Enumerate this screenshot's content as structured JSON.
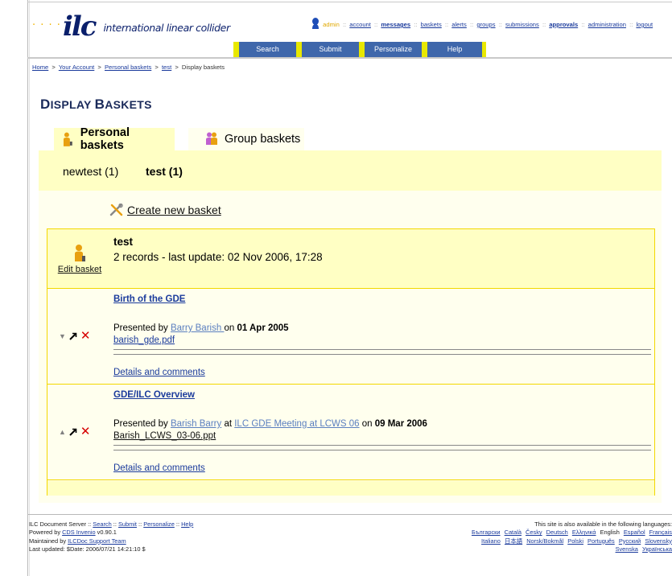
{
  "header": {
    "logo_mark": "ilc",
    "logo_dots": "· · · ·",
    "logo_name": "international linear collider",
    "user_name": "admin",
    "user_links": [
      "account",
      "messages",
      "baskets",
      "alerts",
      "groups",
      "submissions",
      "approvals",
      "administration",
      "logout"
    ],
    "separator": "::"
  },
  "nav": {
    "search": "Search",
    "submit": "Submit",
    "personalize": "Personalize",
    "help": "Help"
  },
  "breadcrumb": {
    "home": "Home",
    "account": "Your Account",
    "personal_baskets": "Personal baskets",
    "test": "test",
    "current": "Display baskets",
    "arrow": ">"
  },
  "page": {
    "title_first": "D",
    "title_rest": "ISPLAY ",
    "title_second": "B",
    "title_rest2": "ASKETS"
  },
  "tabs": {
    "personal": "Personal baskets",
    "group": "Group baskets"
  },
  "subtabs": {
    "first": "newtest (1)",
    "active": "test (1)"
  },
  "actions": {
    "create_basket": "Create new basket"
  },
  "basket": {
    "edit_label": "Edit basket",
    "name": "test",
    "info": "2 records - last update: 02 Nov 2006, 17:28",
    "records": [
      {
        "title": "Birth of the GDE",
        "presented_prefix": "Presented by ",
        "author": "Barry Barish ",
        "mid_text": "",
        "event": "",
        "on_text": "on ",
        "date": "01 Apr 2005",
        "file": "barish_gde.pdf",
        "details": "Details and comments"
      },
      {
        "title": "GDE/ILC Overview",
        "presented_prefix": "Presented by ",
        "author": "Barish Barry",
        "mid_text": " at ",
        "event": "ILC GDE Meeting at LCWS 06",
        "on_text": " on ",
        "date": "09 Mar 2006",
        "file": "Barish_LCWS_03-06.ppt",
        "details": "Details and comments"
      }
    ]
  },
  "footer": {
    "server": "ILC Document Server",
    "sep": "::",
    "search": "Search",
    "submit": "Submit",
    "personalize": "Personalize",
    "help": "Help",
    "powered_prefix": "Powered by ",
    "powered_link": "CDS Invenio",
    "powered_version": " v0.90.1",
    "maintained_prefix": "Maintained by ",
    "maintained_link": "ILCDoc Support Team",
    "last_updated": "Last updated: $Date: 2006/07/21 14:21:10 $",
    "languages_intro": "This site is also available in the following languages:",
    "languages_row1": [
      "Български",
      "Català",
      "Česky",
      "Deutsch",
      "Ελληνικά",
      "English",
      "Español",
      "Français"
    ],
    "languages_row2": [
      "Italiano",
      "日本語",
      "Norsk/Bokmål",
      "Polski",
      "Português",
      "Русский",
      "Slovensky"
    ],
    "languages_row3": [
      "Svenska",
      "Українська"
    ],
    "current_language": "English"
  },
  "colors": {
    "nav_bg": "#3f67ab",
    "nav_divider": "#e8e800",
    "tab_active_bg": "#ffffc4",
    "panel_bg": "#ffffee",
    "border_yellow": "#f3d800",
    "link": "#1a3a9c",
    "delete": "#d60000"
  }
}
